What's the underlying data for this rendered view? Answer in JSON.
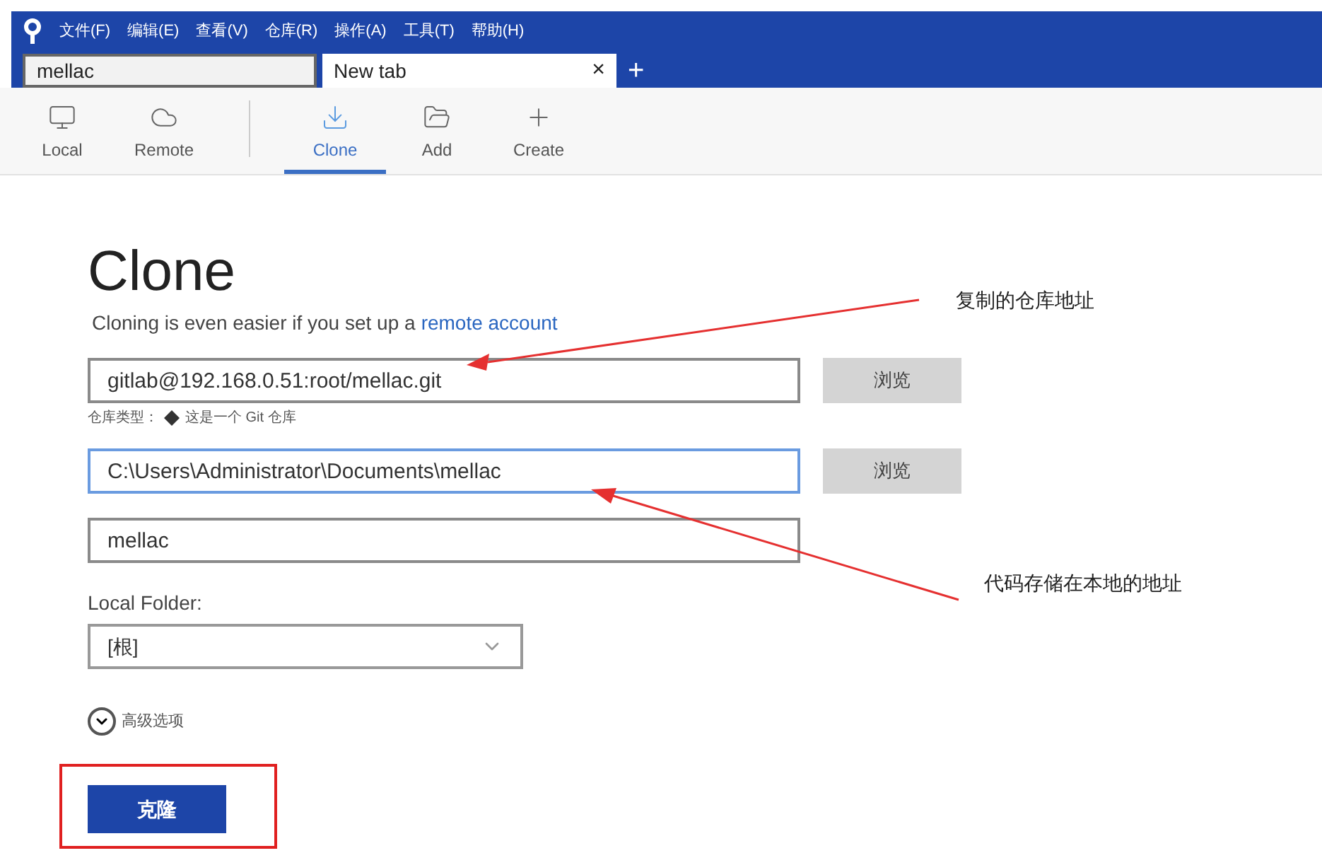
{
  "menu": [
    "文件(F)",
    "编辑(E)",
    "查看(V)",
    "仓库(R)",
    "操作(A)",
    "工具(T)",
    "帮助(H)"
  ],
  "tabs": [
    {
      "label": "mellac",
      "selected": false
    },
    {
      "label": "New tab",
      "selected": true,
      "close": "×"
    }
  ],
  "new_tab": "+",
  "toolbar": [
    {
      "label": "Local",
      "selected": false
    },
    {
      "label": "Remote",
      "selected": false
    },
    {
      "label": "Clone",
      "selected": true
    },
    {
      "label": "Add",
      "selected": false
    },
    {
      "label": "Create",
      "selected": false
    }
  ],
  "title": "Clone",
  "subtitle": {
    "text": "Cloning is even easier if you set up a",
    "link": "remote account"
  },
  "source": {
    "value": "gitlab@192.168.0.51:root/mellac.git",
    "focused": false,
    "browse": "浏览"
  },
  "repo_type": {
    "label": "仓库类型：",
    "value": "这是一个 Git 仓库"
  },
  "destination": {
    "value": "C:\\Users\\Administrator\\Documents\\mellac",
    "focused": true,
    "browse": "浏览"
  },
  "name": {
    "value": "mellac",
    "focused": false
  },
  "local_folder": {
    "label": "Local Folder:",
    "value": "[根]"
  },
  "advanced": {
    "label": "高级选项",
    "expanded": false
  },
  "clone_button": "克隆",
  "annotations": [
    "复制的仓库地址",
    "代码存储在本地的地址"
  ]
}
